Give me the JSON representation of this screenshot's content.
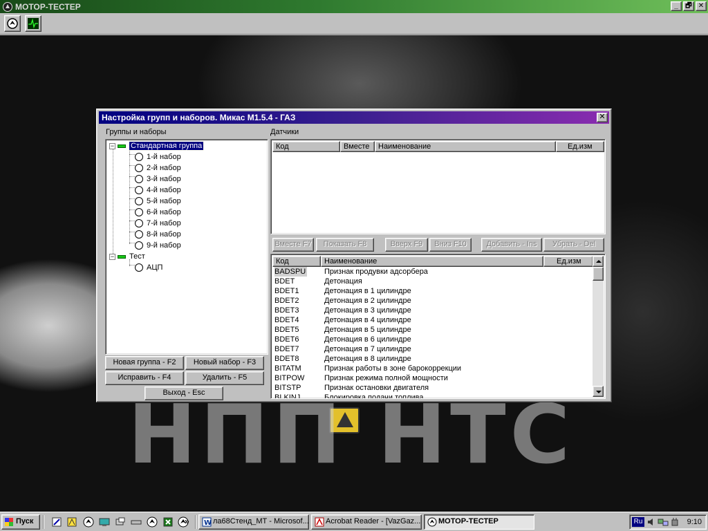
{
  "app": {
    "title": "МОТОР-ТЕСТЕР",
    "window_buttons": [
      "_",
      "🗗",
      "✕"
    ]
  },
  "dialog": {
    "title": "Настройка групп и наборов. Микас М1.5.4 - ГАЗ",
    "close_label": "✕",
    "groups_label": "Группы и наборы",
    "sensors_label": "Датчики",
    "tree": [
      {
        "type": "group",
        "label": "Стандартная группа",
        "expanded": true,
        "selected": true
      },
      {
        "type": "set",
        "label": "1-й набор"
      },
      {
        "type": "set",
        "label": "2-й набор"
      },
      {
        "type": "set",
        "label": "3-й набор"
      },
      {
        "type": "set",
        "label": "4-й набор"
      },
      {
        "type": "set",
        "label": "5-й набор"
      },
      {
        "type": "set",
        "label": "6-й набор"
      },
      {
        "type": "set",
        "label": "7-й набор"
      },
      {
        "type": "set",
        "label": "8-й набор"
      },
      {
        "type": "set",
        "label": "9-й набор"
      },
      {
        "type": "group",
        "label": "Тест",
        "expanded": true
      },
      {
        "type": "set",
        "label": "АЦП"
      }
    ],
    "sensor_columns": [
      "Код",
      "Вместе",
      "Наименование",
      "Ед.изм"
    ],
    "middle_buttons": [
      "Вместе F7",
      "Показать F8",
      "Вверх F9",
      "Вниз F10",
      "Добавить - Ins",
      "Убрать - Del"
    ],
    "catalog_columns": [
      "Код",
      "Наименование",
      "Ед.изм"
    ],
    "catalog_rows": [
      {
        "code": "BADSPU",
        "name": "Признак продувки адсорбера"
      },
      {
        "code": "BDET",
        "name": "Детонация"
      },
      {
        "code": "BDET1",
        "name": "Детонация в 1 цилиндре"
      },
      {
        "code": "BDET2",
        "name": "Детонация в 2 цилиндре"
      },
      {
        "code": "BDET3",
        "name": "Детонация в 3 цилиндре"
      },
      {
        "code": "BDET4",
        "name": "Детонация в 4 цилиндре"
      },
      {
        "code": "BDET5",
        "name": "Детонация в 5 цилиндре"
      },
      {
        "code": "BDET6",
        "name": "Детонация в 6 цилиндре"
      },
      {
        "code": "BDET7",
        "name": "Детонация в 7 цилиндре"
      },
      {
        "code": "BDET8",
        "name": "Детонация в 8 цилиндре"
      },
      {
        "code": "BITATM",
        "name": "Признак работы в зоне барокоррекции"
      },
      {
        "code": "BITPOW",
        "name": "Признак режима полной мощности"
      },
      {
        "code": "BITSTP",
        "name": "Признак остановки двигателя"
      },
      {
        "code": "BLKINJ",
        "name": "Блокировка подачи топлива"
      }
    ],
    "buttons": {
      "new_group": "Новая группа - F2",
      "new_set": "Новый набор - F3",
      "edit": "Исправить - F4",
      "delete": "Удалить - F5",
      "exit": "Выход - Esc"
    }
  },
  "desktop": {
    "watermark": "НПП НТС"
  },
  "taskbar": {
    "start_label": "Пуск",
    "tasks": [
      {
        "label": "ла68Стенд_МТ - Microsof..."
      },
      {
        "label": "Acrobat Reader - [VazGaz...."
      },
      {
        "label": "МОТОР-ТЕСТЕР",
        "active": true
      }
    ],
    "more_label": "»",
    "tray_lang": "Ru",
    "clock": "9:10"
  }
}
